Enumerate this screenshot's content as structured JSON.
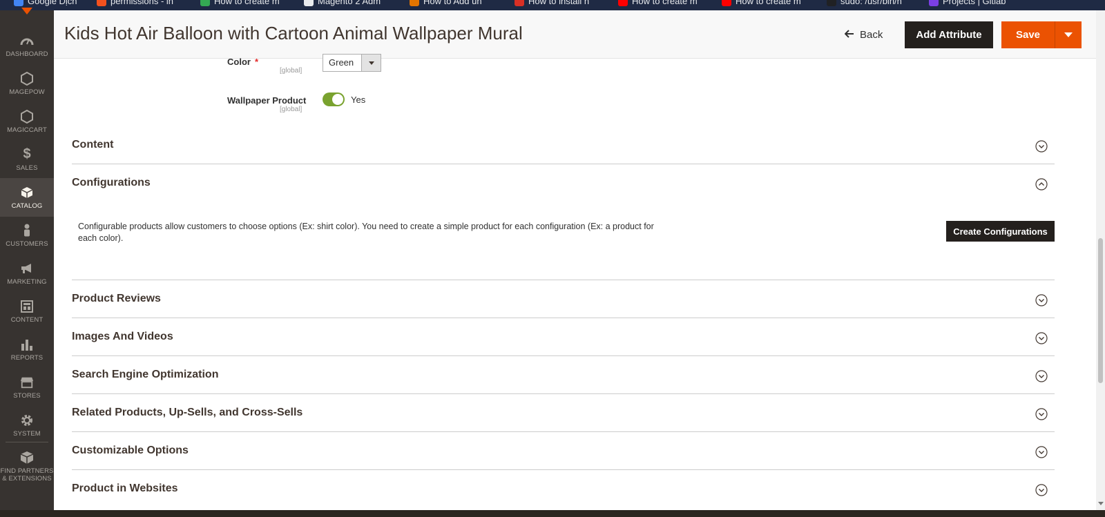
{
  "bookmarks": [
    "Google Dịch",
    "permissions - in",
    "How to create m",
    "Magento 2 Adm",
    "How to Add un",
    "How to install n",
    "How to create m",
    "How to create m",
    "sudo: /usr/bin/n",
    "Projects | Gitlab"
  ],
  "sidebar": {
    "items": [
      {
        "label": "DASHBOARD",
        "icon": "gauge-icon"
      },
      {
        "label": "MAGEPOW",
        "icon": "hexagon-icon"
      },
      {
        "label": "MAGICCART",
        "icon": "hexagon-icon"
      },
      {
        "label": "SALES",
        "icon": "dollar-icon"
      },
      {
        "label": "CATALOG",
        "icon": "box-icon"
      },
      {
        "label": "CUSTOMERS",
        "icon": "person-icon"
      },
      {
        "label": "MARKETING",
        "icon": "megaphone-icon"
      },
      {
        "label": "CONTENT",
        "icon": "layout-icon"
      },
      {
        "label": "REPORTS",
        "icon": "bar-chart-icon"
      },
      {
        "label": "STORES",
        "icon": "storefront-icon"
      },
      {
        "label": "SYSTEM",
        "icon": "gear-icon"
      },
      {
        "label": "FIND PARTNERS & EXTENSIONS",
        "icon": "boxes-icon"
      }
    ],
    "active": "CATALOG"
  },
  "header": {
    "title": "Kids Hot Air Balloon with Cartoon Animal Wallpaper Mural",
    "back_label": "Back",
    "add_attribute_label": "Add Attribute",
    "save_label": "Save"
  },
  "form": {
    "color": {
      "label": "Color",
      "required": "*",
      "scope": "[global]",
      "value": "Green"
    },
    "wallpaper": {
      "label": "Wallpaper Product",
      "scope": "[global]",
      "value": "Yes"
    }
  },
  "sections": [
    {
      "title": "Content",
      "state": "collapsed"
    },
    {
      "title": "Configurations",
      "state": "expanded"
    },
    {
      "title": "Product Reviews",
      "state": "collapsed"
    },
    {
      "title": "Images And Videos",
      "state": "collapsed"
    },
    {
      "title": "Search Engine Optimization",
      "state": "collapsed"
    },
    {
      "title": "Related Products, Up-Sells, and Cross-Sells",
      "state": "collapsed"
    },
    {
      "title": "Customizable Options",
      "state": "collapsed"
    },
    {
      "title": "Product in Websites",
      "state": "collapsed"
    }
  ],
  "configurations": {
    "description": "Configurable products allow customers to choose options (Ex: shirt color). You need to create a simple product for each configuration (Ex: a product for each color).",
    "button_label": "Create Configurations"
  },
  "colors": {
    "accent": "#eb5202",
    "dark_button": "#24201d",
    "toggle_on": "#79a22e",
    "sidebar_bg": "#373330"
  }
}
